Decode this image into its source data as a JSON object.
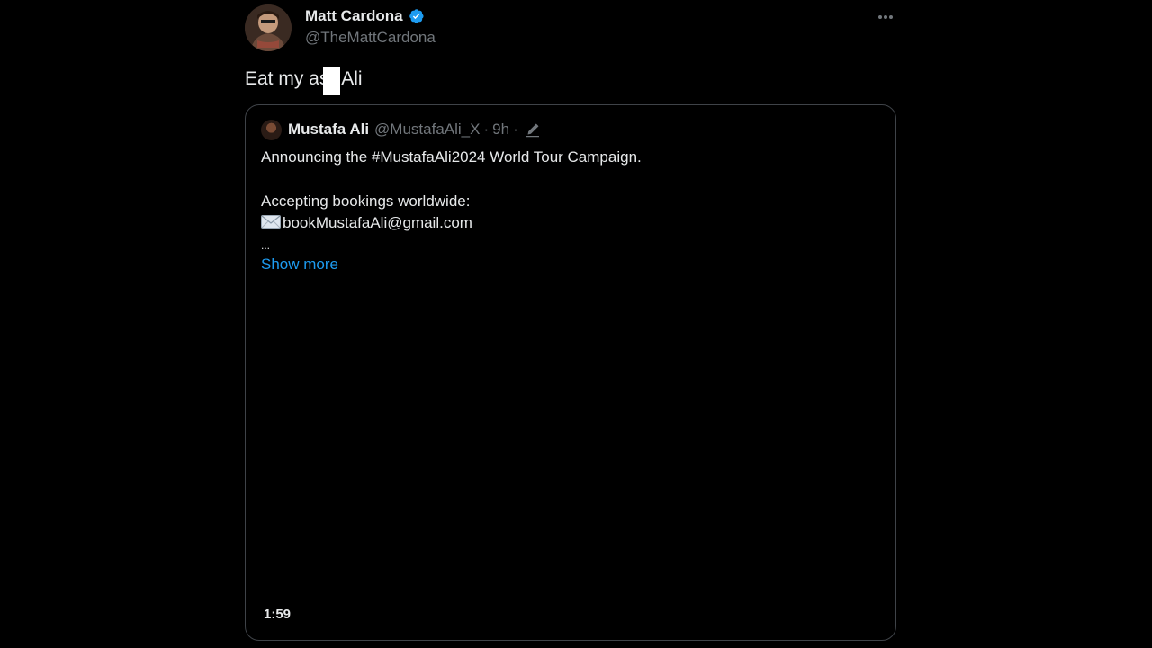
{
  "tweet": {
    "display_name": "Matt Cardona",
    "handle": "@TheMattCardona",
    "text_before": "Eat my as",
    "text_after": "Ali",
    "verified_color": "#1d9bf0",
    "icons": {
      "verified": "verified-badge-icon",
      "more": "more-options-icon"
    }
  },
  "quote": {
    "display_name": "Mustafa Ali",
    "handle": "@MustafaAli_X",
    "separator": "·",
    "time": "9h",
    "separator2": "·",
    "line1": "Announcing the #MustafaAli2024 World Tour Campaign.",
    "line2": "Accepting bookings worldwide:",
    "email": "bookMustafaAli@gmail.com",
    "truncation": "...",
    "show_more": "Show more",
    "video_duration": "1:59",
    "link_color": "#1d9bf0",
    "icons": {
      "edit": "edit-pencil-icon",
      "mail": "envelope-icon"
    }
  }
}
